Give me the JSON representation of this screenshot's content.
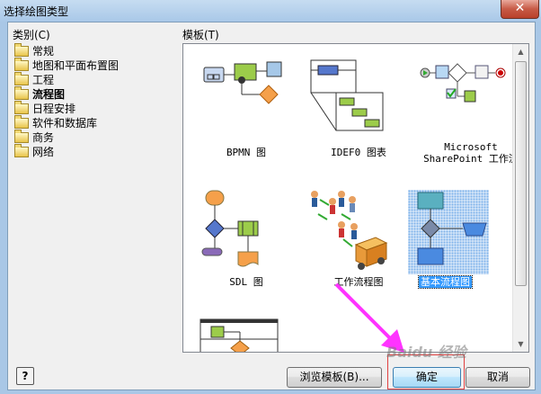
{
  "window": {
    "title": "选择绘图类型",
    "close_icon": "close-icon"
  },
  "categories": {
    "label": "类别(C)",
    "items": [
      {
        "label": "常规",
        "selected": false
      },
      {
        "label": "地图和平面布置图",
        "selected": false
      },
      {
        "label": "工程",
        "selected": false
      },
      {
        "label": "流程图",
        "selected": true
      },
      {
        "label": "日程安排",
        "selected": false
      },
      {
        "label": "软件和数据库",
        "selected": false
      },
      {
        "label": "商务",
        "selected": false
      },
      {
        "label": "网络",
        "selected": false
      }
    ]
  },
  "templates": {
    "label": "模板(T)",
    "items": [
      {
        "label": "BPMN 图",
        "icon": "bpmn-diagram-icon"
      },
      {
        "label": "IDEF0 图表",
        "icon": "idef0-diagram-icon"
      },
      {
        "label": "Microsoft SharePoint 工作流",
        "label_line1": "Microsoft",
        "label_line2": "SharePoint 工作流",
        "icon": "sharepoint-workflow-icon"
      },
      {
        "label": "SDL 图",
        "icon": "sdl-diagram-icon"
      },
      {
        "label": "工作流程图",
        "icon": "work-flow-diagram-icon"
      },
      {
        "label": "基本流程图",
        "icon": "basic-flowchart-icon",
        "selected": true
      },
      {
        "label": "",
        "icon": "cross-functional-flowchart-icon"
      }
    ]
  },
  "buttons": {
    "help": "?",
    "browse": "浏览模板(B)...",
    "ok": "确定",
    "cancel": "取消"
  },
  "watermark": "Baidu 经验",
  "colors": {
    "selection": "#3399ff",
    "annotation_arrow": "#ff33ff",
    "annotation_frame": "#e04040"
  }
}
